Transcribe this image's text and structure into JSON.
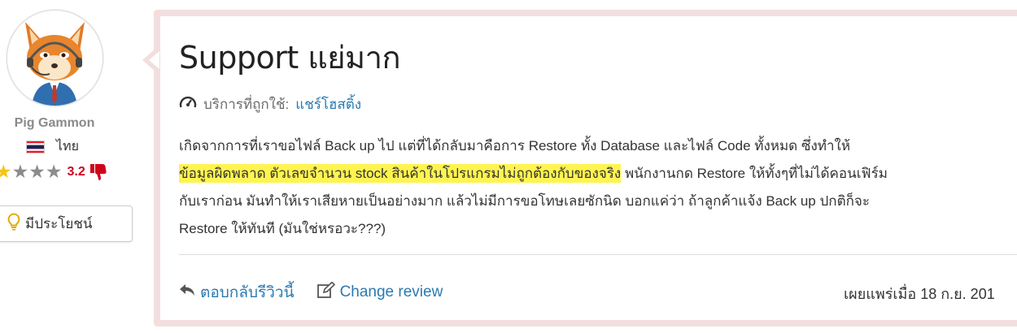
{
  "author": {
    "name": "Pig Gammon",
    "country": "ไทย",
    "rating_value": "3.2",
    "stars_filled": 1,
    "stars_total": 5,
    "helpful_label": "มีประโยชน์"
  },
  "review": {
    "title": "Support แย่มาก",
    "service_label": "บริการที่ถูกใช้:",
    "service_value": "แชร์โฮสติ้ง",
    "lines": [
      "เกิดจากการที่เราขอไฟล์ Back up ไป แต่ที่ได้กลับมาคือการ Restore ทั้ง Database และไฟล์ Code ทั้งหมด ซึ่งทำให้",
      "ข้อมูลผิดพลาด ตัวเลขจำนวน stock สินค้าในโปรแกรมไม่ถูกต้องกับของจริง",
      " พนักงานกด Restore ให้ทั้งๆที่ไม่ได้คอนเฟิร์ม",
      "กับเราก่อน มันทำให้เราเสียหายเป็นอย่างมาก แล้วไม่มีการขอโทษเลยซักนิด บอกแค่ว่า ถ้าลูกค้าแจ้ง Back up ปกติก็จะ",
      "Restore ให้ทันที (มันใช่หรอวะ???)"
    ],
    "reply_label": "ตอบกลับรีวิวนี้",
    "change_label": "Change review",
    "published": "เผยแพร่เมื่อ 18 ก.ย. 201"
  },
  "colors": {
    "link": "#2a7ab0",
    "highlight": "#fff44f",
    "card_border": "#f2dede",
    "rating": "#d0021b",
    "star_on": "#f5c518"
  },
  "icons": {
    "service": "speedometer-icon",
    "reply": "reply-arrow-icon",
    "change": "edit-icon",
    "helpful": "lightbulb-icon",
    "rating_dislike": "thumbs-down-icon"
  }
}
